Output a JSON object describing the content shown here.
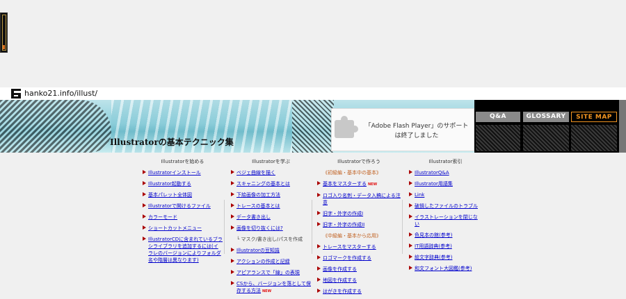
{
  "url": "hanko21.info/illust/",
  "banner": {
    "title": "Illustratorの基本テクニック集"
  },
  "flash": {
    "line1": "「Adobe Flash Player」のサポート",
    "line2": "は終了しました"
  },
  "nav": {
    "qa": "Q&A",
    "glossary": "GLOSSARY",
    "sitemap": "SITE MAP"
  },
  "columns": [
    {
      "heading": "Illustratorを始める",
      "items": [
        {
          "label": "Illustratorインストール",
          "link": true,
          "new": false
        },
        {
          "label": "Illustrator起動する",
          "link": true,
          "new": false
        },
        {
          "label": "基本パレット全体図",
          "link": true,
          "new": false
        },
        {
          "label": "Illustratorで開けるファイル",
          "link": true,
          "new": false
        },
        {
          "label": "カラーモード",
          "link": true,
          "new": false
        },
        {
          "label": "ショートカットメニュー",
          "link": true,
          "new": false
        },
        {
          "label": "IllustratorCDに含まれているブラシライブラリを追加するには(イラレのバージョンによりフォルダ名や階層は異なります)",
          "link": true,
          "new": false
        }
      ]
    },
    {
      "heading": "Illustratorを学ぶ",
      "items": [
        {
          "label": "ベジェ曲線を描く",
          "link": true,
          "new": false
        },
        {
          "label": "スキャニングの基本とは",
          "link": true,
          "new": false
        },
        {
          "label": "下絵画像の加工方法",
          "link": true,
          "new": false
        },
        {
          "label": "トレースの基本とは",
          "link": true,
          "new": false
        },
        {
          "label": "データ書き出し",
          "link": true,
          "new": false
        },
        {
          "label": "画像を切り抜くには?",
          "link": true,
          "new": false
        },
        {
          "label": "└ マスク/書き出し/パスを作成",
          "link": false,
          "note": true,
          "new": false
        },
        {
          "label": "Illustratorの豆知識",
          "link": true,
          "new": false
        },
        {
          "label": "アクションの作成と記録",
          "link": true,
          "new": false
        },
        {
          "label": "アピアランスで「線」の表現",
          "link": true,
          "new": false
        },
        {
          "label": "CSから、バージョンを落として保存する方法",
          "link": true,
          "new": true
        }
      ]
    },
    {
      "heading": "Illustratorで作ろう",
      "items": [
        {
          "label": "《初級編・基本中の基本》",
          "link": false,
          "sub": true,
          "new": false
        },
        {
          "label": "基本をマスターする",
          "link": true,
          "new": true
        },
        {
          "label": "ロゴ入り名刺・データ入稿による注意",
          "link": true,
          "new": false
        },
        {
          "label": "旧字・外字の作成I",
          "link": true,
          "new": false
        },
        {
          "label": "旧字・外字の作成II",
          "link": true,
          "new": false
        },
        {
          "label": "《中級編・基本から応用》",
          "link": false,
          "sub": true,
          "new": false
        },
        {
          "label": "トレースをマスターする",
          "link": true,
          "new": false
        },
        {
          "label": "ロゴマークを作成する",
          "link": true,
          "new": false
        },
        {
          "label": "画像を作成する",
          "link": true,
          "new": false
        },
        {
          "label": "地図を作成する",
          "link": true,
          "new": false
        },
        {
          "label": "はがきを作成する",
          "link": true,
          "new": false
        }
      ]
    },
    {
      "heading": "Illustrator索引",
      "items": [
        {
          "label": "IllustratorQ&A",
          "link": true,
          "new": false
        },
        {
          "label": "Illustrator用語集",
          "link": true,
          "new": false
        },
        {
          "label": "Link",
          "link": true,
          "new": false
        },
        {
          "label": "破損したファイルのトラブル",
          "link": true,
          "new": false
        },
        {
          "label": "イラストレーションを閉じない",
          "link": true,
          "new": false
        },
        {
          "label": "色見本の館(参考)",
          "link": true,
          "new": false
        },
        {
          "label": "IT用語辞典(参考)",
          "link": true,
          "new": false
        },
        {
          "label": "絵文字辞典(参考)",
          "link": true,
          "new": false
        },
        {
          "label": "和文フォント大図鑑(参考)",
          "link": true,
          "new": false
        }
      ]
    }
  ],
  "new_badge": "NEW"
}
